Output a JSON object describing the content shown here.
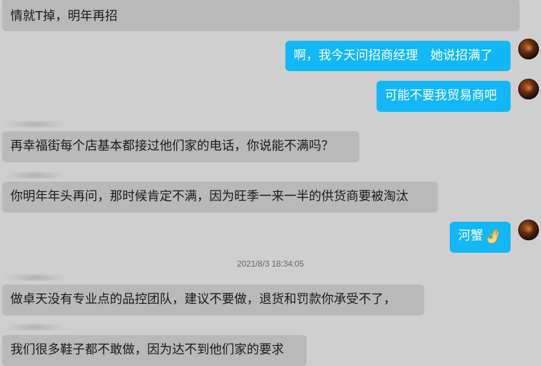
{
  "messages": [
    {
      "side": "in",
      "text": "情就T掉，明年再招"
    },
    {
      "side": "out",
      "text": "啊，我今天问招商经理　她说招满了"
    },
    {
      "side": "out",
      "text": "可能不要我贸易商吧"
    },
    {
      "side": "in",
      "text": "再幸福街每个店基本都接过他们家的电话，你说能不满吗？"
    },
    {
      "side": "in",
      "text": "你明年年头再问，那时候肯定不满，因为旺季一来一半的供货商要被淘汰"
    },
    {
      "side": "out",
      "text": "河蟹",
      "emoji": "ok-hand-icon"
    },
    {
      "side": "in",
      "text": "做卓天没有专业点的品控团队，建议不要做，退货和罚款你承受不了，"
    },
    {
      "side": "in",
      "text": "我们很多鞋子都不敢做，因为达不到他们家的要求"
    }
  ],
  "timestamp": "2021/8/3 18:34:05",
  "colors": {
    "background": "#cfcfcf",
    "incoming_bubble": "#b9b9b9",
    "outgoing_bubble": "#12b7f5"
  }
}
